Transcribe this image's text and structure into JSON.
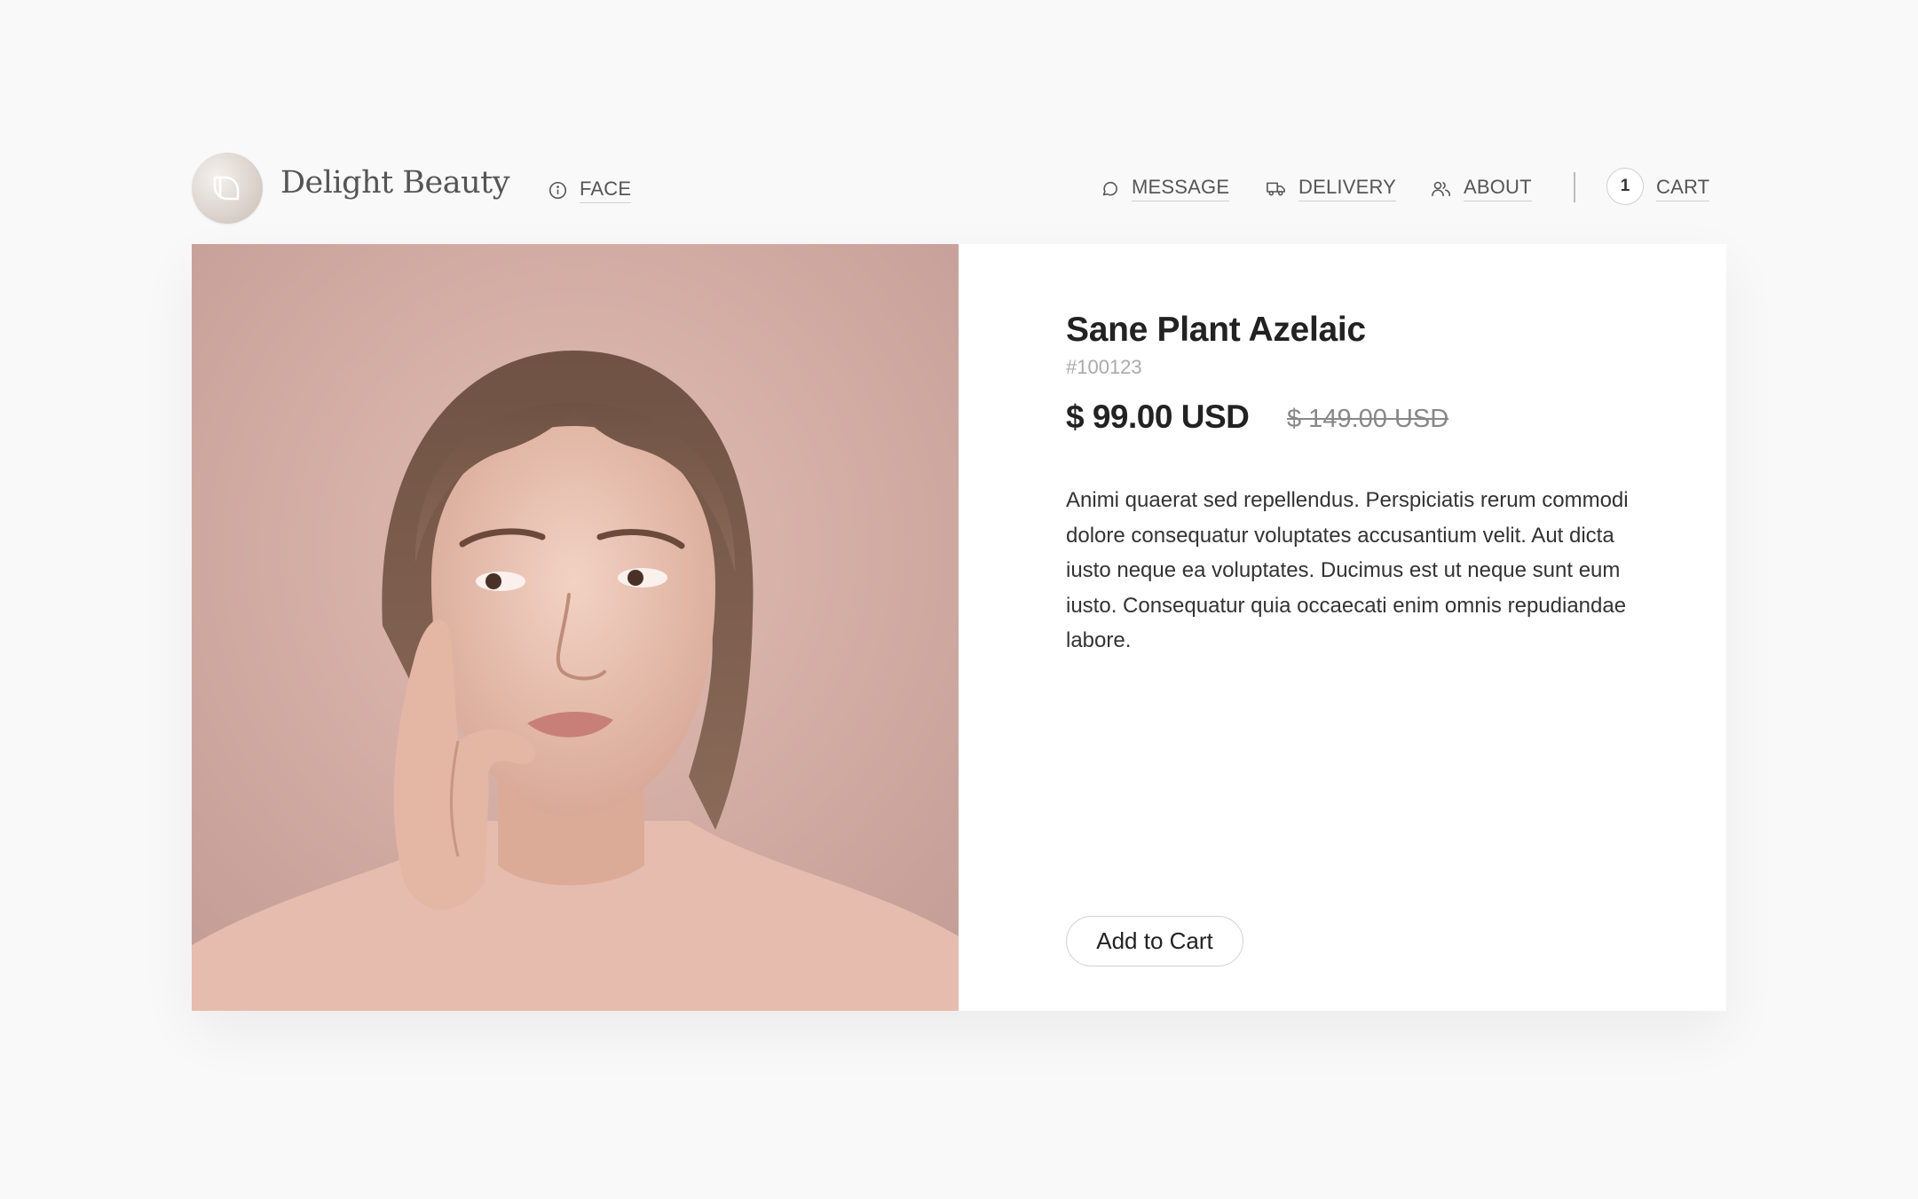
{
  "brand": {
    "name": "Delight Beauty",
    "logo_icon": "leaf-logo-icon"
  },
  "nav": {
    "face": {
      "label": "FACE",
      "icon": "info-icon"
    },
    "right": [
      {
        "label": "MESSAGE",
        "icon": "chat-bubble-icon"
      },
      {
        "label": "DELIVERY",
        "icon": "truck-icon"
      },
      {
        "label": "ABOUT",
        "icon": "users-icon"
      }
    ],
    "cart": {
      "count": "1",
      "label": "CART"
    }
  },
  "product": {
    "title": "Sane Plant Azelaic",
    "sku": "#100123",
    "price": "$ 99.00 USD",
    "old_price": "$ 149.00 USD",
    "description": "Animi quaerat sed repellendus. Perspiciatis rerum commodi dolore consequatur voluptates accusantium velit. Aut dicta iusto neque ea voluptates. Ducimus est ut neque sunt eum iusto. Consequatur quia occaecati enim omnis repudiandae labore.",
    "add_to_cart_label": "Add to Cart",
    "image": "woman-portrait-photo"
  },
  "colors": {
    "background": "#f9f9fa",
    "card": "#ffffff",
    "photo_backdrop": "#c9a49c",
    "text": "#222222",
    "muted": "#888888"
  }
}
